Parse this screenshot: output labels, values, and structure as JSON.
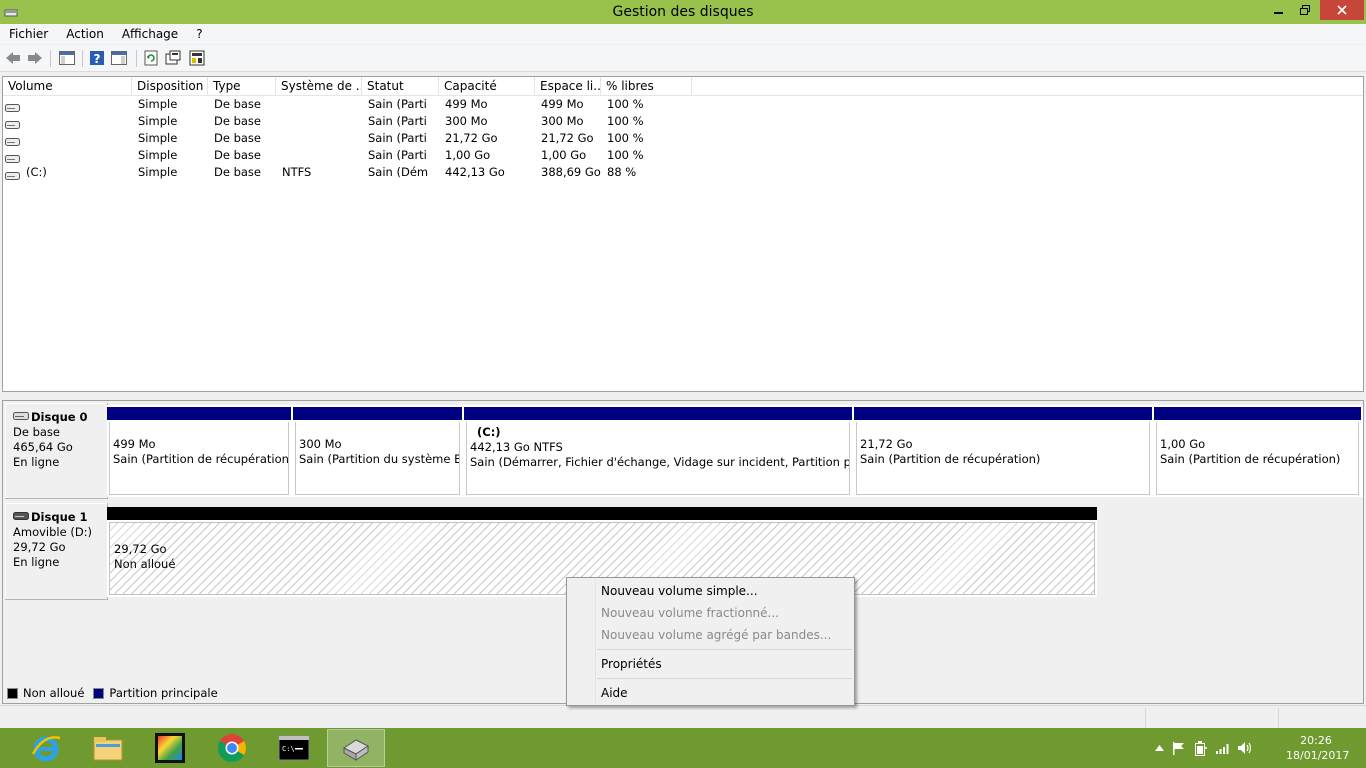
{
  "window": {
    "title": "Gestion des disques"
  },
  "menu": {
    "items": [
      "Fichier",
      "Action",
      "Affichage",
      "?"
    ]
  },
  "volume_list": {
    "columns": [
      "Volume",
      "Disposition",
      "Type",
      "Système de ...",
      "Statut",
      "Capacité",
      "Espace li...",
      "% libres"
    ],
    "rows": [
      [
        "",
        "Simple",
        "De base",
        "",
        "Sain (Parti",
        "499 Mo",
        "499 Mo",
        "100 %"
      ],
      [
        "",
        "Simple",
        "De base",
        "",
        "Sain (Parti",
        "300 Mo",
        "300 Mo",
        "100 %"
      ],
      [
        "",
        "Simple",
        "De base",
        "",
        "Sain (Parti",
        "21,72 Go",
        "21,72 Go",
        "100 %"
      ],
      [
        "",
        "Simple",
        "De base",
        "",
        "Sain (Parti",
        "1,00 Go",
        "1,00 Go",
        "100 %"
      ],
      [
        "(C:)",
        "Simple",
        "De base",
        "NTFS",
        "Sain (Dém",
        "442,13 Go",
        "388,69 Go",
        "88 %"
      ]
    ]
  },
  "disks": [
    {
      "name": "Disque 0",
      "type": "De base",
      "size": "465,64 Go",
      "status": "En ligne",
      "partitions": [
        {
          "label": "",
          "size": "499 Mo",
          "status": "Sain (Partition de récupération)"
        },
        {
          "label": "",
          "size": "300 Mo",
          "status": "Sain (Partition du système EFI"
        },
        {
          "label": "(C:)",
          "size": "442,13 Go NTFS",
          "status": "Sain (Démarrer, Fichier d'échange, Vidage sur incident, Partition princip"
        },
        {
          "label": "",
          "size": "21,72 Go",
          "status": "Sain (Partition de récupération)"
        },
        {
          "label": "",
          "size": "1,00 Go",
          "status": "Sain (Partition de récupération)"
        }
      ]
    },
    {
      "name": "Disque 1",
      "type": "Amovible (D:)",
      "size": "29,72 Go",
      "status": "En ligne",
      "partitions": [
        {
          "size": "29,72 Go",
          "status": "Non alloué"
        }
      ]
    }
  ],
  "legend": [
    {
      "label": "Non alloué",
      "color": "#000000"
    },
    {
      "label": "Partition principale",
      "color": "#000080"
    }
  ],
  "context_menu": {
    "items": [
      {
        "label": "Nouveau volume simple...",
        "enabled": true
      },
      {
        "label": "Nouveau volume fractionné...",
        "enabled": false
      },
      {
        "label": "Nouveau volume agrégé par bandes...",
        "enabled": false
      },
      {
        "label": "Propriétés",
        "enabled": true
      },
      {
        "label": "Aide",
        "enabled": true
      }
    ]
  },
  "taskbar": {
    "time": "20:26",
    "date": "18/01/2017",
    "colors": {
      "taskbar": "#6e9a2f",
      "titlebar": "#98c24b"
    }
  }
}
